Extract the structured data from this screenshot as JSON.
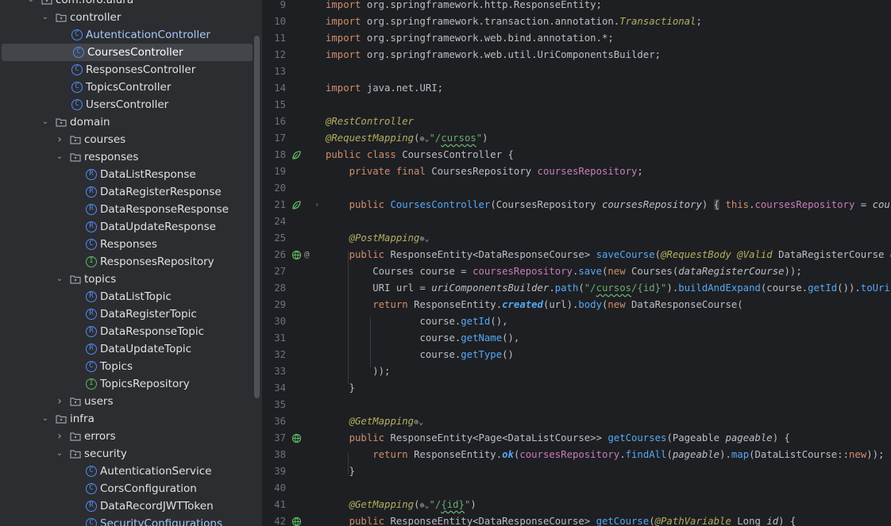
{
  "project_tree": {
    "rows": [
      {
        "label": "com.foro.alura",
        "kind": "package",
        "depth": 2,
        "expanded": true
      },
      {
        "label": "controller",
        "kind": "package",
        "depth": 3,
        "expanded": true
      },
      {
        "label": "AutenticationController",
        "kind": "class",
        "depth": 4
      },
      {
        "label": "CoursesController",
        "kind": "class",
        "depth": 4,
        "selected": true
      },
      {
        "label": "ResponsesController",
        "kind": "class",
        "depth": 4
      },
      {
        "label": "TopicsController",
        "kind": "class",
        "depth": 4
      },
      {
        "label": "UsersController",
        "kind": "class",
        "depth": 4
      },
      {
        "label": "domain",
        "kind": "package",
        "depth": 3,
        "expanded": true
      },
      {
        "label": "courses",
        "kind": "package",
        "depth": 4,
        "expanded": false
      },
      {
        "label": "responses",
        "kind": "package",
        "depth": 4,
        "expanded": true
      },
      {
        "label": "DataListResponse",
        "kind": "record",
        "depth": 5
      },
      {
        "label": "DataRegisterResponse",
        "kind": "record",
        "depth": 5
      },
      {
        "label": "DataResponseResponse",
        "kind": "record",
        "depth": 5
      },
      {
        "label": "DataUpdateResponse",
        "kind": "record",
        "depth": 5
      },
      {
        "label": "Responses",
        "kind": "class",
        "depth": 5
      },
      {
        "label": "ResponsesRepository",
        "kind": "interface",
        "depth": 5
      },
      {
        "label": "topics",
        "kind": "package",
        "depth": 4,
        "expanded": true
      },
      {
        "label": "DataListTopic",
        "kind": "record",
        "depth": 5
      },
      {
        "label": "DataRegisterTopic",
        "kind": "record",
        "depth": 5
      },
      {
        "label": "DataResponseTopic",
        "kind": "record",
        "depth": 5
      },
      {
        "label": "DataUpdateTopic",
        "kind": "record",
        "depth": 5
      },
      {
        "label": "Topics",
        "kind": "class",
        "depth": 5
      },
      {
        "label": "TopicsRepository",
        "kind": "interface",
        "depth": 5
      },
      {
        "label": "users",
        "kind": "package",
        "depth": 4,
        "expanded": false
      },
      {
        "label": "infra",
        "kind": "package",
        "depth": 3,
        "expanded": true
      },
      {
        "label": "errors",
        "kind": "package",
        "depth": 4,
        "expanded": false
      },
      {
        "label": "security",
        "kind": "package",
        "depth": 4,
        "expanded": true
      },
      {
        "label": "AutenticationService",
        "kind": "class",
        "depth": 5
      },
      {
        "label": "CorsConfiguration",
        "kind": "class",
        "depth": 5
      },
      {
        "label": "DataRecordJWTToken",
        "kind": "record",
        "depth": 5
      },
      {
        "label": "SecurityConfigurations",
        "kind": "class",
        "depth": 5
      }
    ]
  },
  "editor": {
    "lines": [
      {
        "n": "9",
        "tokens": [
          [
            "kw",
            "import "
          ],
          [
            "t",
            "org.springframework.http.ResponseEntity;"
          ]
        ]
      },
      {
        "n": "10",
        "tokens": [
          [
            "kw",
            "import "
          ],
          [
            "t",
            "org.springframework.transaction.annotation."
          ],
          [
            "an",
            "Transactional"
          ],
          [
            "t",
            ";"
          ]
        ]
      },
      {
        "n": "11",
        "tokens": [
          [
            "kw",
            "import "
          ],
          [
            "t",
            "org.springframework.web.bind.annotation.*;"
          ]
        ]
      },
      {
        "n": "12",
        "tokens": [
          [
            "kw",
            "import "
          ],
          [
            "t",
            "org.springframework.web.util.UriComponentsBuilder;"
          ]
        ]
      },
      {
        "n": "13",
        "tokens": []
      },
      {
        "n": "14",
        "tokens": [
          [
            "kw",
            "import "
          ],
          [
            "t",
            "java.net.URI;"
          ]
        ]
      },
      {
        "n": "15",
        "tokens": []
      },
      {
        "n": "16",
        "tokens": [
          [
            "an",
            "@RestController"
          ]
        ]
      },
      {
        "n": "17",
        "tokens": [
          [
            "an",
            "@RequestMapping"
          ],
          [
            "t",
            "("
          ],
          [
            "g",
            "⊕⌄"
          ],
          [
            "st",
            "\"/"
          ],
          [
            "sq",
            "cursos"
          ],
          [
            "st",
            "\""
          ],
          [
            "t",
            ")"
          ]
        ],
        "gutter": ""
      },
      {
        "n": "18",
        "tokens": [
          [
            "kw",
            "public class "
          ],
          [
            "t",
            "CoursesController {"
          ]
        ],
        "gutter": "bean"
      },
      {
        "n": "19",
        "tokens": [
          [
            "t",
            "    "
          ],
          [
            "kw",
            "private final "
          ],
          [
            "t",
            "CoursesRepository "
          ],
          [
            "fi",
            "coursesRepository"
          ],
          [
            "t",
            ";"
          ]
        ]
      },
      {
        "n": "20",
        "tokens": []
      },
      {
        "n": "21",
        "tokens": [
          [
            "t",
            "    "
          ],
          [
            "kw",
            "public "
          ],
          [
            "fn",
            "CoursesController"
          ],
          [
            "t",
            "(CoursesRepository "
          ],
          [
            "pa",
            "coursesRepository"
          ],
          [
            "t",
            ") "
          ],
          [
            "fold",
            "{"
          ],
          [
            "t",
            " "
          ],
          [
            "kw",
            "this"
          ],
          [
            "t",
            "."
          ],
          [
            "fi",
            "coursesRepository"
          ],
          [
            "t",
            " = "
          ],
          [
            "pa",
            "coursesRe"
          ]
        ],
        "gutter": "bean"
      },
      {
        "n": "24",
        "tokens": []
      },
      {
        "n": "25",
        "tokens": [
          [
            "t",
            "    "
          ],
          [
            "an",
            "@PostMapping"
          ],
          [
            "g",
            "⊕⌄"
          ]
        ]
      },
      {
        "n": "26",
        "tokens": [
          [
            "t",
            "    "
          ],
          [
            "kw",
            "public "
          ],
          [
            "t",
            "ResponseEntity<DataResponseCourse> "
          ],
          [
            "fn",
            "saveCourse"
          ],
          [
            "t",
            "("
          ],
          [
            "an",
            "@RequestBody @Valid "
          ],
          [
            "t",
            "DataRegisterCourse "
          ],
          [
            "pa",
            "dataRe"
          ]
        ],
        "gutter": "web"
      },
      {
        "n": "27",
        "tokens": [
          [
            "t",
            "        Courses course = "
          ],
          [
            "fi",
            "coursesRepository"
          ],
          [
            "t",
            "."
          ],
          [
            "fn",
            "save"
          ],
          [
            "t",
            "("
          ],
          [
            "kw",
            "new "
          ],
          [
            "t",
            "Courses("
          ],
          [
            "pa",
            "dataRegisterCourse"
          ],
          [
            "t",
            "));"
          ]
        ]
      },
      {
        "n": "28",
        "tokens": [
          [
            "t",
            "        URI url = "
          ],
          [
            "pa",
            "uriComponentsBuilder"
          ],
          [
            "t",
            "."
          ],
          [
            "fn",
            "path"
          ],
          [
            "t",
            "("
          ],
          [
            "st",
            "\"/"
          ],
          [
            "sq",
            "cursos"
          ],
          [
            "st",
            "/{id}\""
          ],
          [
            "t",
            ")."
          ],
          [
            "fn",
            "buildAndExpand"
          ],
          [
            "t",
            "(course."
          ],
          [
            "fn",
            "getId"
          ],
          [
            "t",
            "())."
          ],
          [
            "fn",
            "toUri"
          ],
          [
            "t",
            "();"
          ]
        ]
      },
      {
        "n": "29",
        "tokens": [
          [
            "t",
            "        "
          ],
          [
            "kw",
            "return "
          ],
          [
            "t",
            "ResponseEntity."
          ],
          [
            "fnb",
            "created"
          ],
          [
            "t",
            "(url)."
          ],
          [
            "fn",
            "body"
          ],
          [
            "t",
            "("
          ],
          [
            "kw",
            "new "
          ],
          [
            "t",
            "DataResponseCourse("
          ]
        ]
      },
      {
        "n": "30",
        "tokens": [
          [
            "t",
            "                course."
          ],
          [
            "fn",
            "getId"
          ],
          [
            "t",
            "(),"
          ]
        ]
      },
      {
        "n": "31",
        "tokens": [
          [
            "t",
            "                course."
          ],
          [
            "fn",
            "getName"
          ],
          [
            "t",
            "(),"
          ]
        ]
      },
      {
        "n": "32",
        "tokens": [
          [
            "t",
            "                course."
          ],
          [
            "fn",
            "getType"
          ],
          [
            "t",
            "()"
          ]
        ]
      },
      {
        "n": "33",
        "tokens": [
          [
            "t",
            "        ));"
          ]
        ]
      },
      {
        "n": "34",
        "tokens": [
          [
            "t",
            "    }"
          ]
        ]
      },
      {
        "n": "35",
        "tokens": []
      },
      {
        "n": "36",
        "tokens": [
          [
            "t",
            "    "
          ],
          [
            "an",
            "@GetMapping"
          ],
          [
            "g",
            "⊕⌄"
          ]
        ]
      },
      {
        "n": "37",
        "tokens": [
          [
            "t",
            "    "
          ],
          [
            "kw",
            "public "
          ],
          [
            "t",
            "ResponseEntity<Page<DataListCourse>> "
          ],
          [
            "fn",
            "getCourses"
          ],
          [
            "t",
            "(Pageable "
          ],
          [
            "pa",
            "pageable"
          ],
          [
            "t",
            ") {"
          ]
        ],
        "gutter": "web"
      },
      {
        "n": "38",
        "tokens": [
          [
            "t",
            "        "
          ],
          [
            "kw",
            "return "
          ],
          [
            "t",
            "ResponseEntity."
          ],
          [
            "fnb",
            "ok"
          ],
          [
            "t",
            "("
          ],
          [
            "fi",
            "coursesRepository"
          ],
          [
            "t",
            "."
          ],
          [
            "fn",
            "findAll"
          ],
          [
            "t",
            "("
          ],
          [
            "pa",
            "pageable"
          ],
          [
            "t",
            ")."
          ],
          [
            "fn",
            "map"
          ],
          [
            "t",
            "(DataListCourse::"
          ],
          [
            "kw",
            "new"
          ],
          [
            "t",
            "));"
          ]
        ]
      },
      {
        "n": "39",
        "tokens": [
          [
            "t",
            "    }"
          ]
        ]
      },
      {
        "n": "40",
        "tokens": []
      },
      {
        "n": "41",
        "tokens": [
          [
            "t",
            "    "
          ],
          [
            "an",
            "@GetMapping"
          ],
          [
            "t",
            "("
          ],
          [
            "g",
            "⊕⌄"
          ],
          [
            "st",
            "\"/"
          ],
          [
            "sq",
            "{id}"
          ],
          [
            "st",
            "\""
          ],
          [
            "t",
            ")"
          ]
        ]
      },
      {
        "n": "42",
        "tokens": [
          [
            "t",
            "    "
          ],
          [
            "kw",
            "public "
          ],
          [
            "t",
            "ResponseEntity<DataResponseCourse> "
          ],
          [
            "fn",
            "getCourse"
          ],
          [
            "t",
            "("
          ],
          [
            "an",
            "@PathVariable "
          ],
          [
            "t",
            "Long "
          ],
          [
            "pa",
            "id"
          ],
          [
            "t",
            ") {"
          ]
        ],
        "gutter": "web"
      }
    ]
  }
}
